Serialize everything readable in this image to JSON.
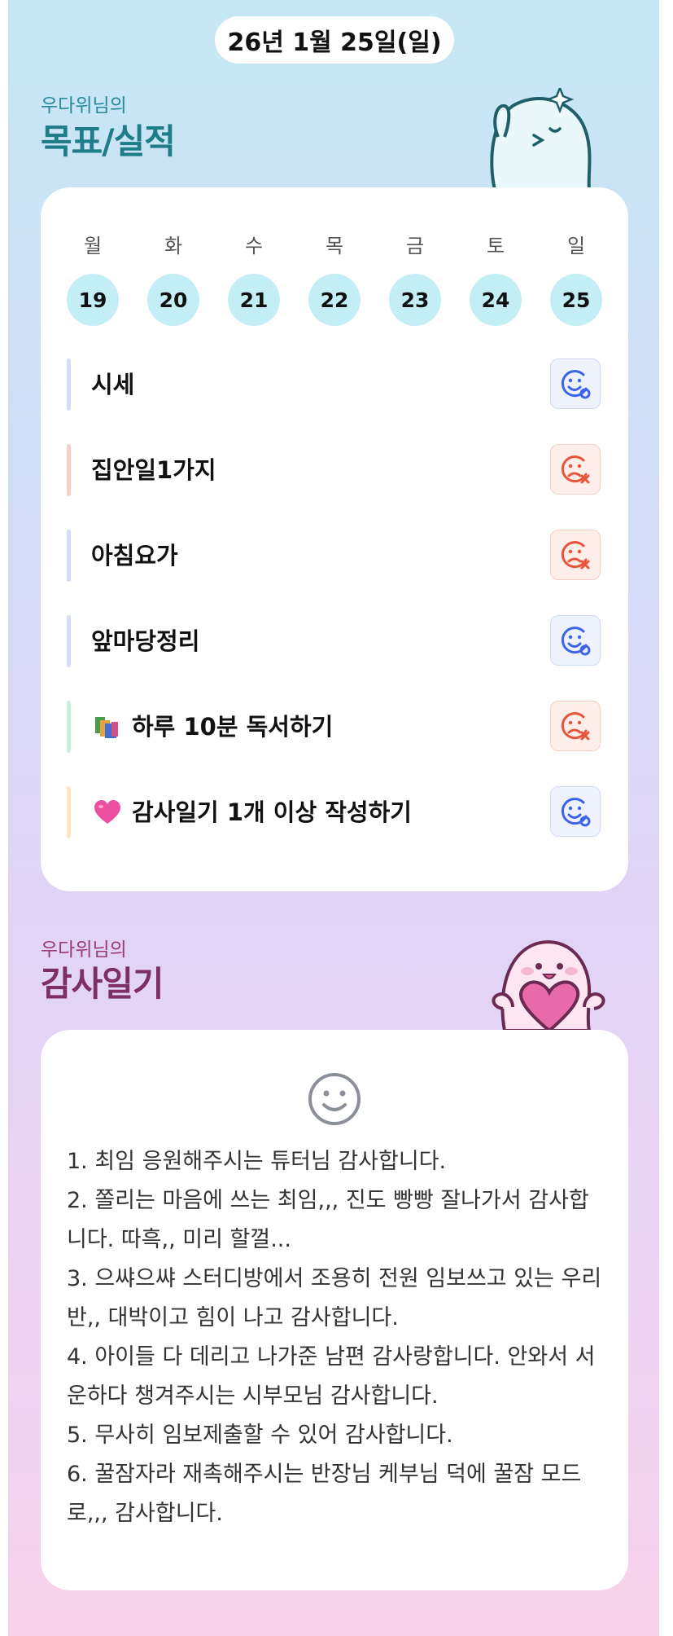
{
  "header": {
    "date": "26년 1월 25일(일)"
  },
  "goals_section": {
    "owner": "우다위님의",
    "title": "목표/실적",
    "weekdays": [
      "월",
      "화",
      "수",
      "목",
      "금",
      "토",
      "일"
    ],
    "days": [
      "19",
      "20",
      "21",
      "22",
      "23",
      "24",
      "25"
    ],
    "goals": [
      {
        "label": "시세",
        "emoji": "",
        "status": "good",
        "bar_color": "#d6ddf7"
      },
      {
        "label": "집안일1가지",
        "emoji": "",
        "status": "bad",
        "bar_color": "#f8cfc8"
      },
      {
        "label": "아침요가",
        "emoji": "",
        "status": "bad",
        "bar_color": "#d6ddf7"
      },
      {
        "label": "앞마당정리",
        "emoji": "",
        "status": "good",
        "bar_color": "#d6ddf7"
      },
      {
        "label": "하루 10분 독서하기",
        "emoji": "books-icon",
        "status": "bad",
        "bar_color": "#c8efdc"
      },
      {
        "label": "감사일기 1개 이상 작성하기",
        "emoji": "heart-icon",
        "status": "good",
        "bar_color": "#fbe3c4"
      }
    ]
  },
  "diary_section": {
    "owner": "우다위님의",
    "title": "감사일기",
    "text": "1. 최임 응원해주시는 튜터님 감사합니다.\n2. 쫄리는 마음에 쓰는 최임,,, 진도 빵빵 잘나가서 감사합니다. 따흑,, 미리 할껄...\n3. 으쌰으쌰 스터디방에서 조용히 전원 임보쓰고 있는 우리반,, 대박이고 힘이 나고 감사합니다.\n4. 아이들 다 데리고 나가준 남편 감사랑합니다. 안와서 서운하다 챙겨주시는 시부모님 감사합니다.\n5. 무사히 임보제출할 수 있어 감사합니다.\n6. 꿀잠자라 재촉해주시는 반장님 케부님 덕에 꿀잠 모드로,,, 감사합니다."
  },
  "colors": {
    "goals_owner": "#2a8a9a",
    "goals_title": "#1e7d86",
    "diary_owner": "#9a3c74",
    "diary_title": "#7d2f63",
    "good_icon": "#3d63ea",
    "bad_icon": "#e8533b"
  }
}
